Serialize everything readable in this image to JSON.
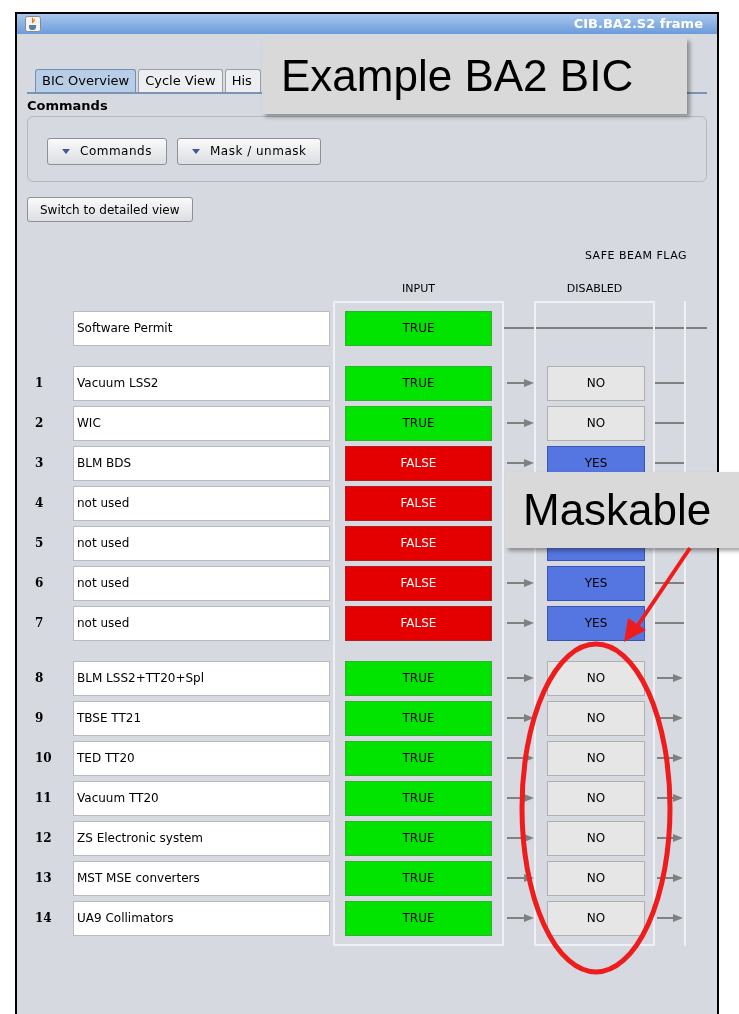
{
  "window": {
    "title": "CIB.BA2.S2 frame"
  },
  "tabs": [
    {
      "label": "BIC Overview",
      "selected": true
    },
    {
      "label": "Cycle View",
      "selected": false
    },
    {
      "label": "His",
      "selected": false
    }
  ],
  "commands": {
    "title": "Commands",
    "buttons": [
      "Commands",
      "Mask / unmask"
    ]
  },
  "switch_button": "Switch to detailed view",
  "safe_beam_flag": "SAFE BEAM FLAG",
  "columns": {
    "input": "INPUT",
    "disabled": "DISABLED"
  },
  "software_permit": {
    "name": "Software Permit",
    "input": "TRUE",
    "ok": true
  },
  "groups": [
    [
      {
        "number": "1",
        "name": "Vacuum LSS2",
        "input": "TRUE",
        "ok": true,
        "disabled": "NO",
        "masked": false,
        "maskable": false
      },
      {
        "number": "2",
        "name": "WIC",
        "input": "TRUE",
        "ok": true,
        "disabled": "NO",
        "masked": false,
        "maskable": false
      },
      {
        "number": "3",
        "name": "BLM BDS",
        "input": "FALSE",
        "ok": false,
        "disabled": "YES",
        "masked": true,
        "maskable": false
      },
      {
        "number": "4",
        "name": "not used",
        "input": "FALSE",
        "ok": false,
        "maskable": false
      },
      {
        "number": "5",
        "name": "not used",
        "input": "FALSE",
        "ok": false,
        "masked": true,
        "maskable": false
      },
      {
        "number": "6",
        "name": "not used",
        "input": "FALSE",
        "ok": false,
        "disabled": "YES",
        "masked": true,
        "maskable": false
      },
      {
        "number": "7",
        "name": "not used",
        "input": "FALSE",
        "ok": false,
        "disabled": "YES",
        "masked": true,
        "maskable": false
      }
    ],
    [
      {
        "number": "8",
        "name": "BLM LSS2+TT20+Spl",
        "input": "TRUE",
        "ok": true,
        "disabled": "NO",
        "masked": false,
        "maskable": true
      },
      {
        "number": "9",
        "name": "TBSE TT21",
        "input": "TRUE",
        "ok": true,
        "disabled": "NO",
        "masked": false,
        "maskable": true
      },
      {
        "number": "10",
        "name": "TED TT20",
        "input": "TRUE",
        "ok": true,
        "disabled": "NO",
        "masked": false,
        "maskable": true
      },
      {
        "number": "11",
        "name": "Vacuum TT20",
        "input": "TRUE",
        "ok": true,
        "disabled": "NO",
        "masked": false,
        "maskable": true
      },
      {
        "number": "12",
        "name": "ZS Electronic system",
        "input": "TRUE",
        "ok": true,
        "disabled": "NO",
        "masked": false,
        "maskable": true
      },
      {
        "number": "13",
        "name": "MST MSE converters",
        "input": "TRUE",
        "ok": true,
        "disabled": "NO",
        "masked": false,
        "maskable": true
      },
      {
        "number": "14",
        "name": "UA9 Collimators",
        "input": "TRUE",
        "ok": true,
        "disabled": "NO",
        "masked": false,
        "maskable": true
      }
    ]
  ],
  "callouts": [
    {
      "kind": "title",
      "text": "Example BA2 BIC"
    },
    {
      "kind": "pointer",
      "text": "Maskable"
    }
  ]
}
